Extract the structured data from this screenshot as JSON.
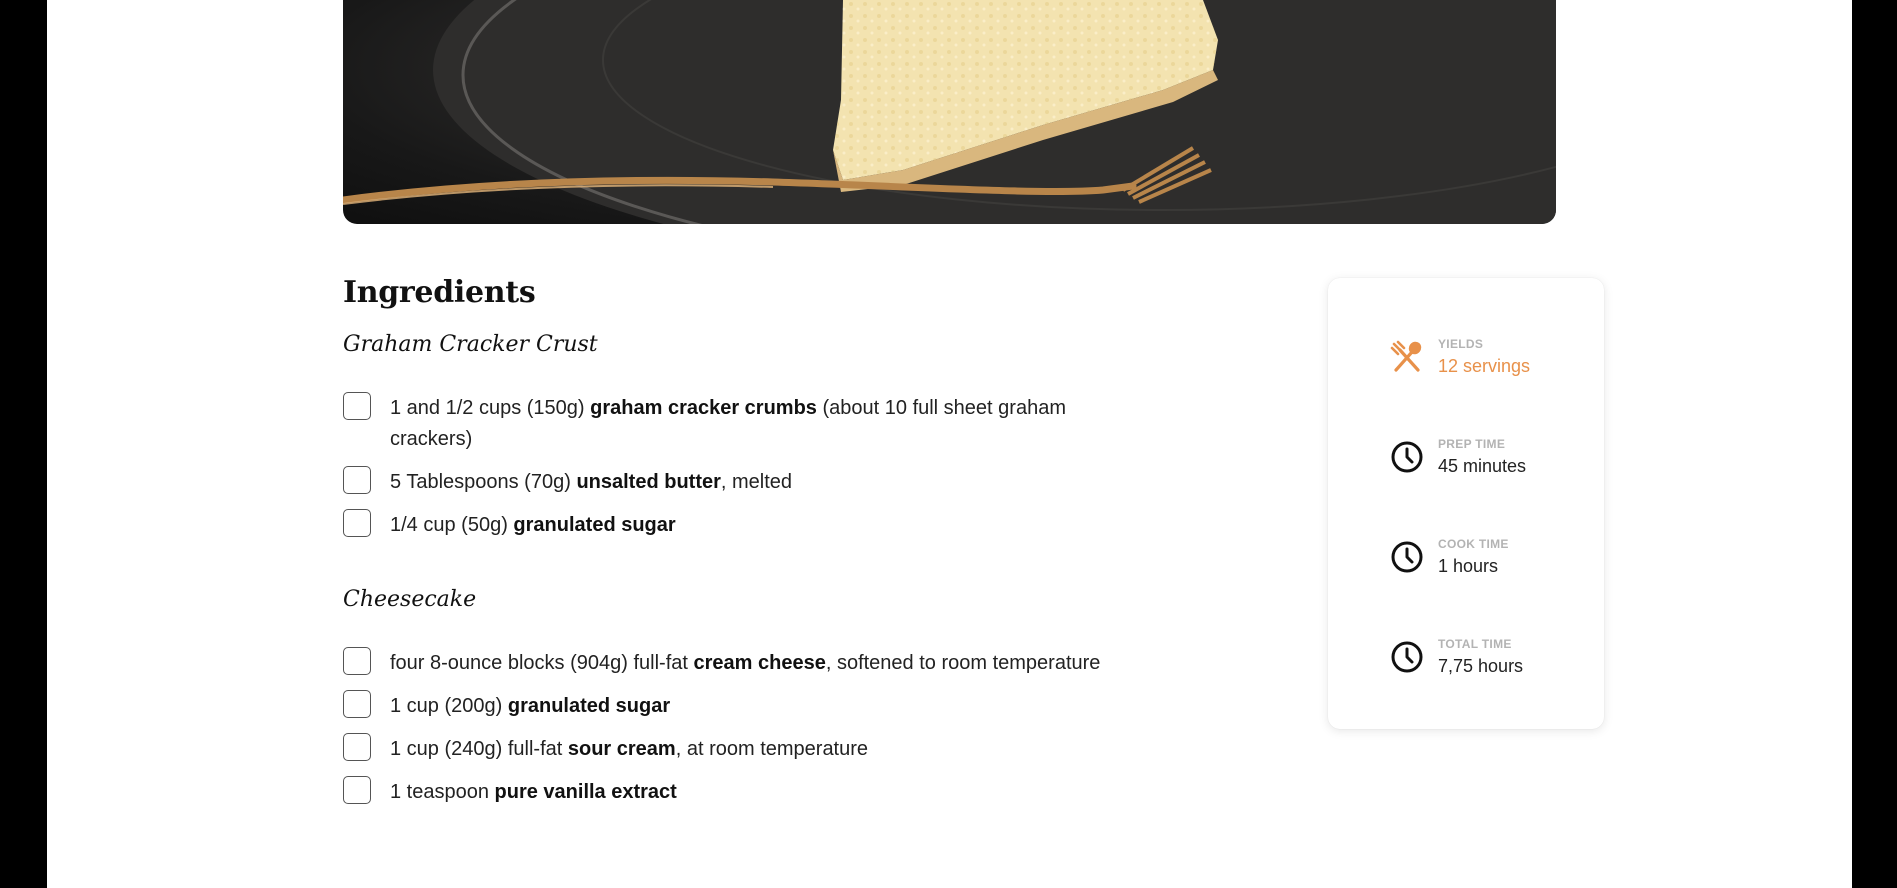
{
  "colors": {
    "accent": "#e8914a",
    "label_gray": "#b3b3b3"
  },
  "hero": {
    "icon": "cheesecake-photo"
  },
  "ingredients": {
    "heading": "Ingredients",
    "groups": [
      {
        "title": "Graham Cracker Crust",
        "items": [
          {
            "pre": "1 and 1/2 cups (150g) ",
            "bold": "graham cracker crumbs",
            "post": " (about 10 full sheet graham crackers)"
          },
          {
            "pre": "5 Tablespoons (70g) ",
            "bold": "unsalted butter",
            "post": ", melted"
          },
          {
            "pre": "1/4 cup (50g) ",
            "bold": "granulated sugar",
            "post": ""
          }
        ]
      },
      {
        "title": "Cheesecake",
        "items": [
          {
            "pre": "four 8-ounce blocks (904g) full-fat ",
            "bold": "cream cheese",
            "post": ", softened to room temperature"
          },
          {
            "pre": "1 cup (200g) ",
            "bold": "granulated sugar",
            "post": ""
          },
          {
            "pre": "1 cup (240g) full-fat ",
            "bold": "sour cream",
            "post": ", at room temperature"
          },
          {
            "pre": "1 teaspoon ",
            "bold": "pure vanilla extract",
            "post": ""
          }
        ]
      }
    ]
  },
  "info_card": {
    "yields": {
      "label": "YIELDS",
      "value": "12 servings",
      "icon": "utensils-icon"
    },
    "prep": {
      "label": "PREP TIME",
      "value": "45 minutes",
      "icon": "clock-icon"
    },
    "cook": {
      "label": "COOK TIME",
      "value": "1 hours",
      "icon": "clock-icon"
    },
    "total": {
      "label": "TOTAL TIME",
      "value": "7,75 hours",
      "icon": "clock-icon"
    }
  }
}
